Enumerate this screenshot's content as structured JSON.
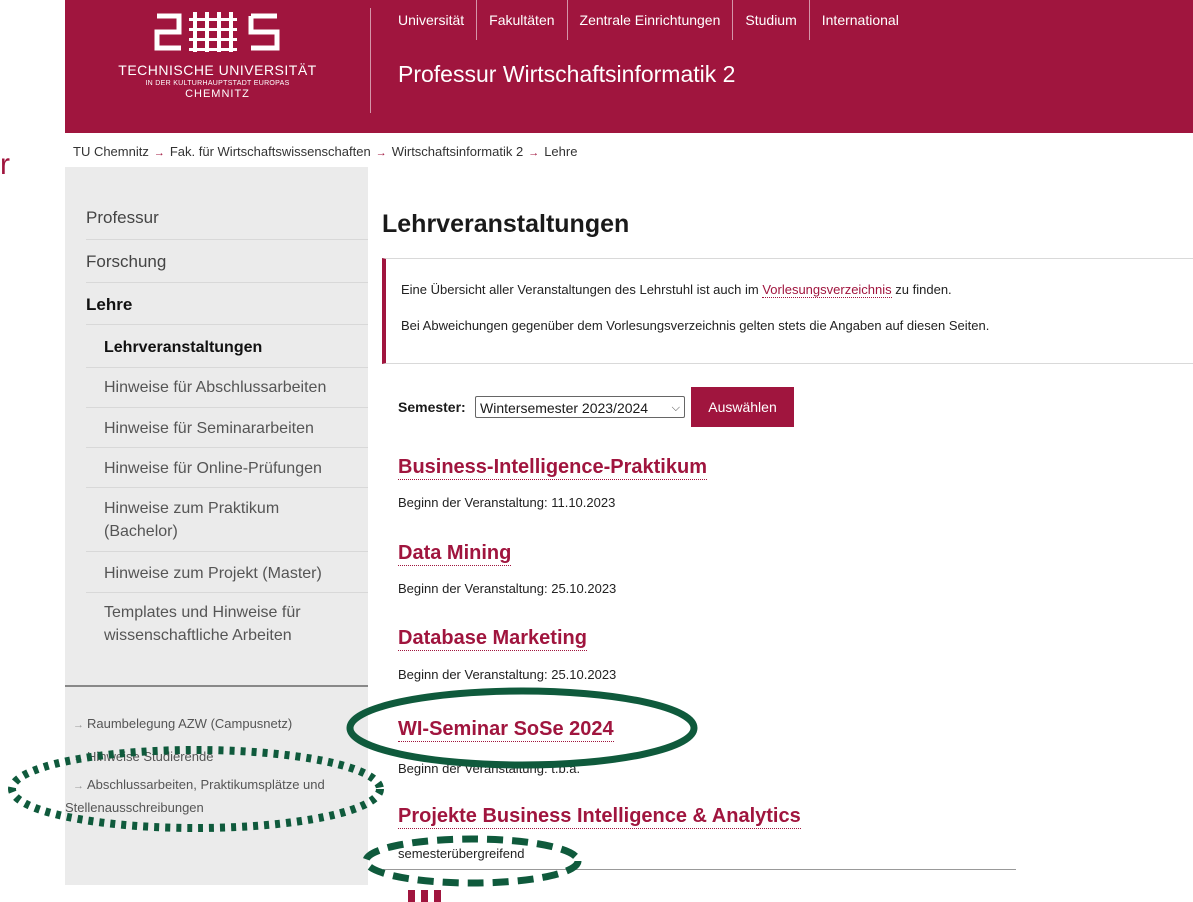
{
  "stray_char": "r",
  "header": {
    "logo_lines": [
      "TECHNISCHE UNIVERSITÄT",
      "IN DER KULTURHAUPTSTADT EUROPAS",
      "CHEMNITZ"
    ],
    "nav": [
      "Universität",
      "Fakultäten",
      "Zentrale Einrichtungen",
      "Studium",
      "International"
    ],
    "department": "Professur Wirtschaftsinformatik 2"
  },
  "breadcrumb": [
    "TU Chemnitz",
    "Fak. für Wirtschaftswissenschaften",
    "Wirtschaftsinformatik 2",
    "Lehre"
  ],
  "sidebar": {
    "top_items": [
      "Professur",
      "Forschung",
      "Lehre"
    ],
    "sub_items": [
      "Lehrveranstaltungen",
      "Hinweise für Abschlussarbeiten",
      "Hinweise für Seminararbeiten",
      "Hinweise für Online-Prüfungen",
      "Hinweise zum Praktikum (Bachelor)",
      "Hinweise zum Projekt (Master)",
      "Templates und Hinweise für wissenschaftliche Arbeiten"
    ],
    "active_sub": "Lehrveranstaltungen",
    "links": [
      "Raumbelegung AZW (Campusnetz)",
      "Hinweise Studierende",
      "Abschlussarbeiten, Praktikumsplätze und Stellenausschreibungen"
    ]
  },
  "main": {
    "title": "Lehrveranstaltungen",
    "notice": {
      "line1_before": "Eine Übersicht aller Veranstaltungen des Lehrstuhl ist auch im ",
      "line1_link": "Vorlesungsverzeichnis",
      "line1_after": " zu finden.",
      "line2": "Bei Abweichungen gegenüber dem Vorlesungsverzeichnis gelten stets die Angaben auf diesen Seiten."
    },
    "semester_label": "Semester:",
    "semester_value": "Wintersemester 2023/2024",
    "select_button": "Auswählen",
    "courses": [
      {
        "title": "Business-Intelligence-Praktikum",
        "info": "Beginn der Veranstaltung: 11.10.2023"
      },
      {
        "title": "Data Mining",
        "info": "Beginn der Veranstaltung: 25.10.2023"
      },
      {
        "title": "Database Marketing",
        "info": "Beginn der Veranstaltung: 25.10.2023"
      },
      {
        "title": "WI-Seminar SoSe 2024",
        "info": "Beginn der Veranstaltung: t.b.a."
      },
      {
        "title": "Projekte Business Intelligence & Analytics",
        "info": "semesterübergreifend"
      }
    ]
  },
  "colors": {
    "brand": "#a0153e",
    "sidebar_bg": "#ebebeb",
    "annotation": "#0f5a3c"
  },
  "icons": {
    "breadcrumb_separator": "arrow-right-icon",
    "select_chevron": "chevron-down-icon",
    "logo": "tu-chemnitz-logo"
  }
}
